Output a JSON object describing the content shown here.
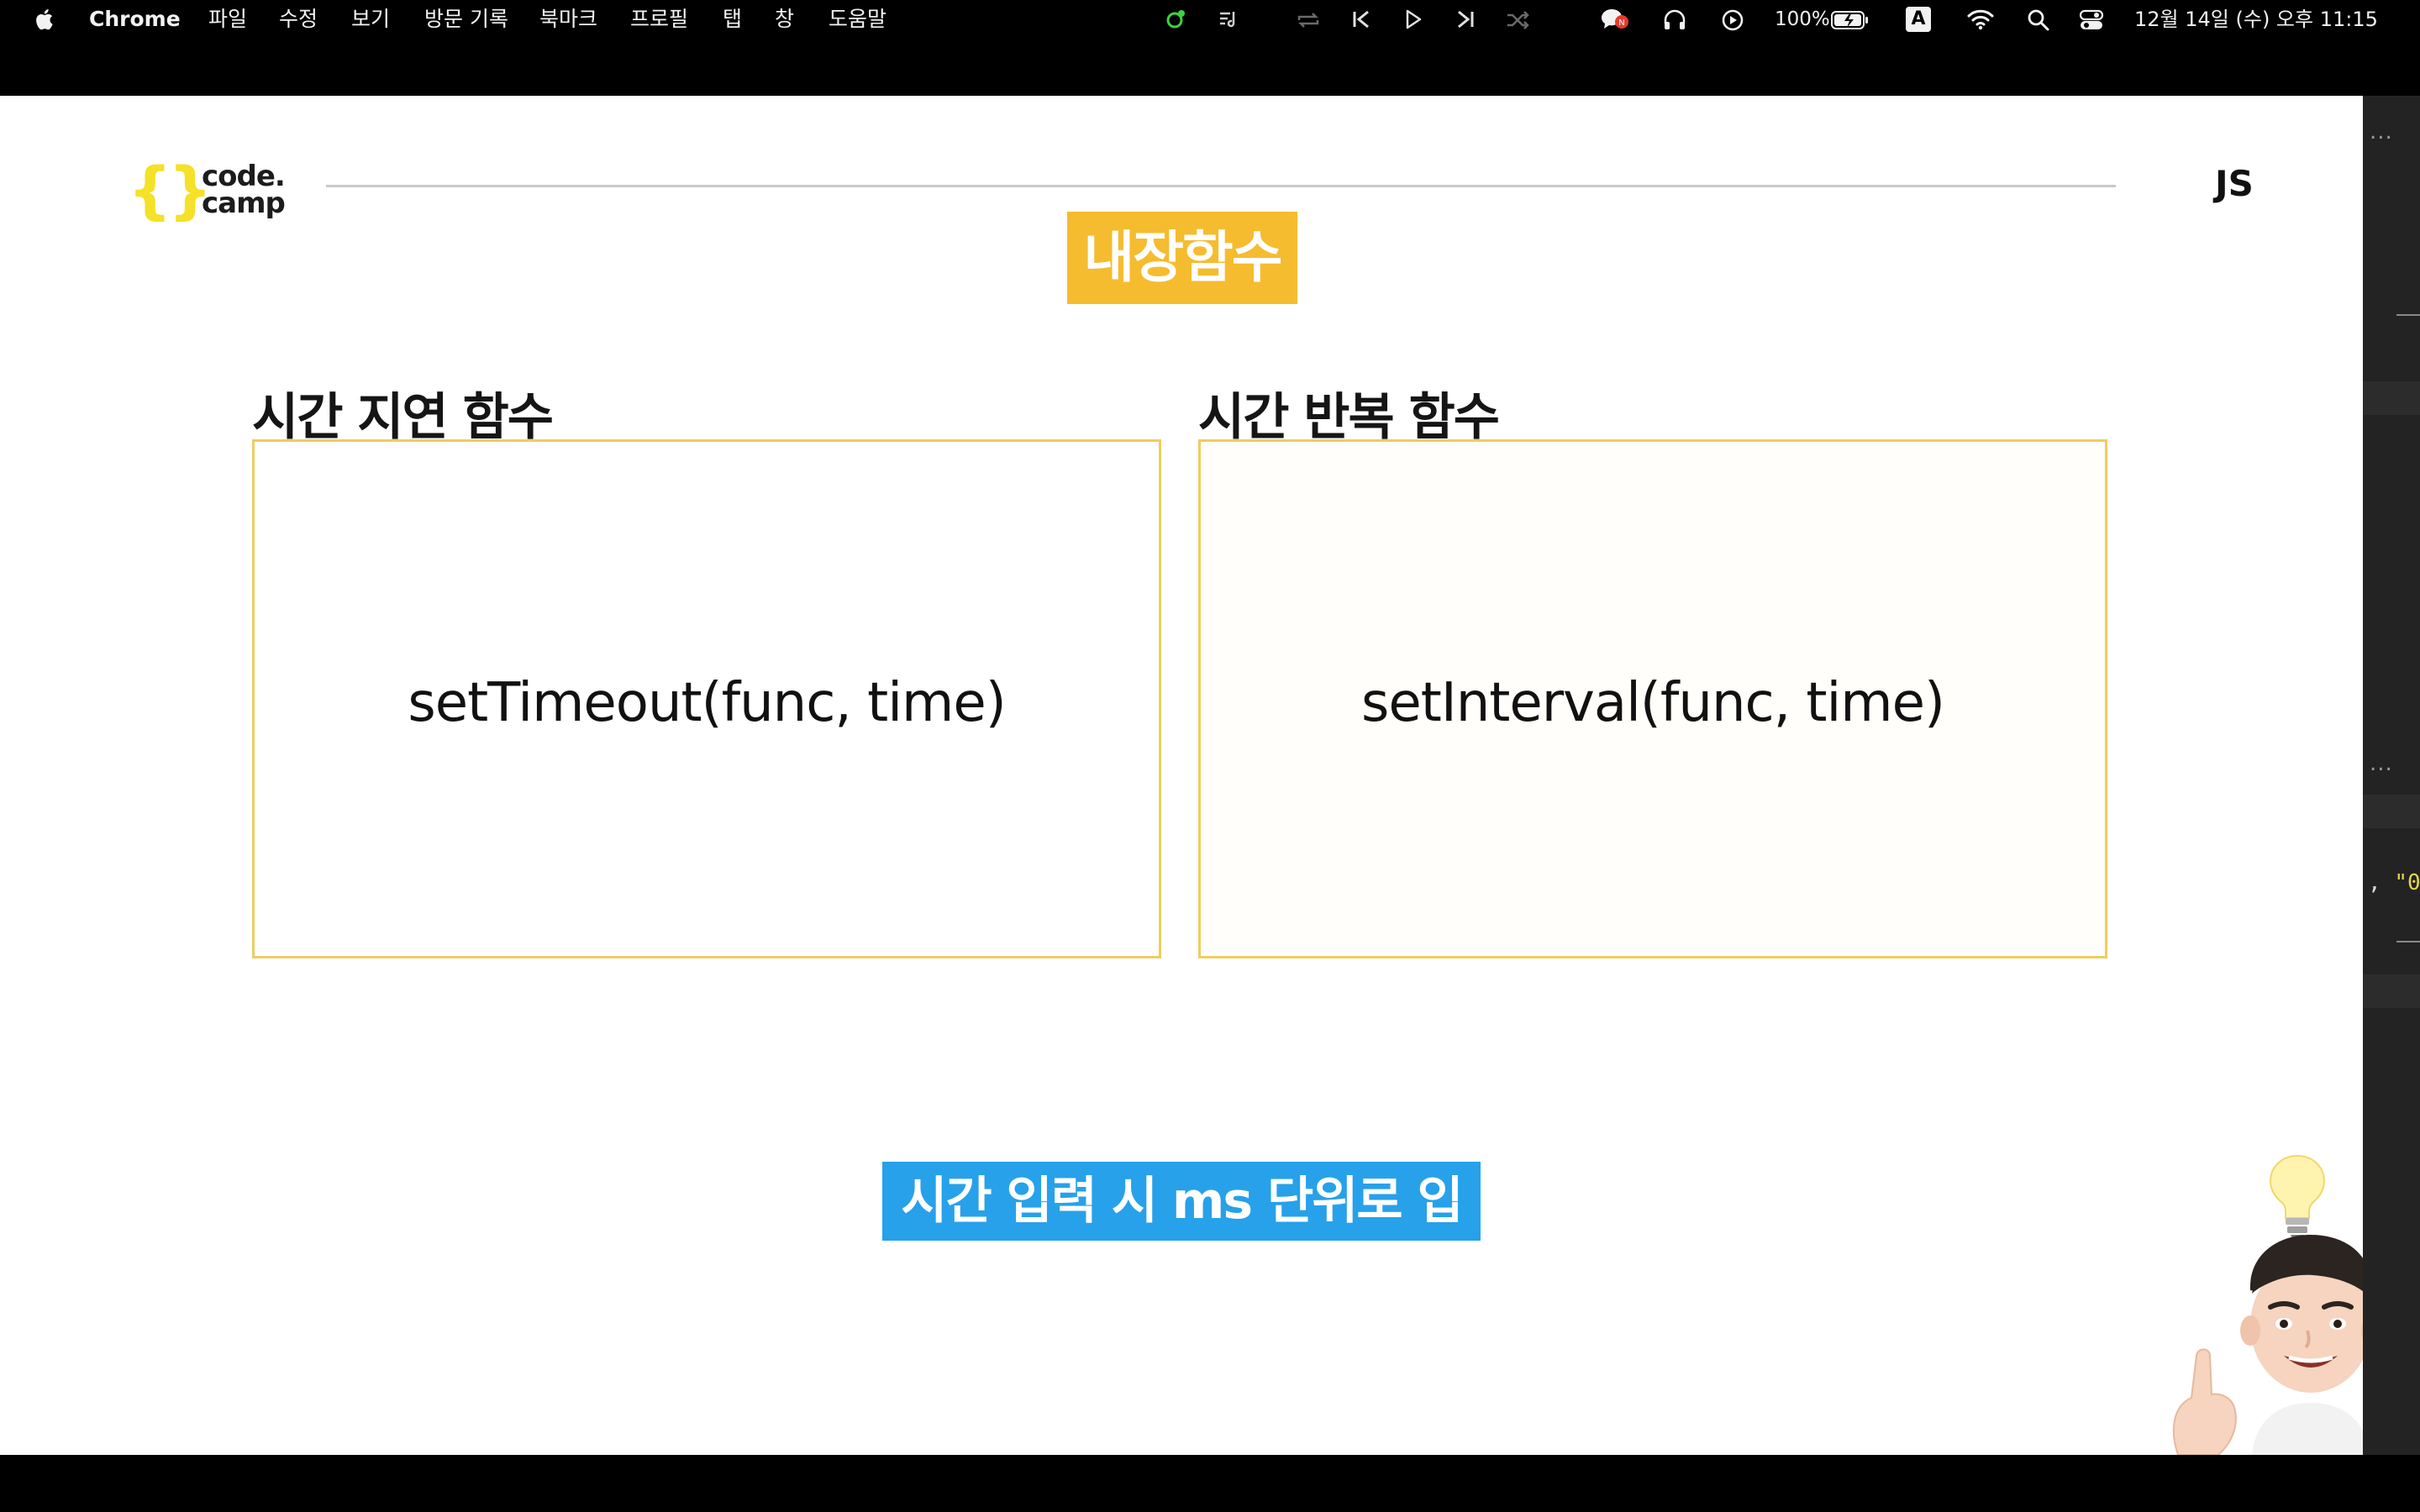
{
  "menubar": {
    "app_name": "Chrome",
    "menus": [
      "파일",
      "수정",
      "보기",
      "방문 기록",
      "북마크",
      "프로필",
      "탭",
      "창",
      "도움말"
    ],
    "battery": "100%",
    "input_source": "A",
    "datetime": "12월 14일 (수) 오후  11:15",
    "icons": [
      "apple-icon",
      "media-dot-icon",
      "lyrics-icon",
      "repeat-icon",
      "previous-icon",
      "play-icon",
      "next-icon",
      "shuffle-icon",
      "notification-icon",
      "headphones-icon",
      "playback-icon",
      "battery-icon",
      "input-source-icon",
      "wifi-icon",
      "search-icon",
      "control-center-icon"
    ]
  },
  "slide": {
    "logo_line1": "code.",
    "logo_line2": "camp",
    "corner_label": "JS",
    "title": "내장함수",
    "left_section": {
      "label": "시간 지연 함수",
      "code": "setTimeout(func, time)"
    },
    "right_section": {
      "label": "시간 반복 함수",
      "code": "setInterval(func, time)"
    },
    "note": "시간 입력 시 ms 단위로 입력",
    "colors": {
      "title_badge": "#f5bc30",
      "note_badge": "#27a1ea",
      "box_border": "#f1cc5f",
      "logo_brace": "#f4e128"
    }
  },
  "side_panel": {
    "dots": "...",
    "code_snippet_punct": ", ",
    "code_snippet_string": "\"0"
  }
}
